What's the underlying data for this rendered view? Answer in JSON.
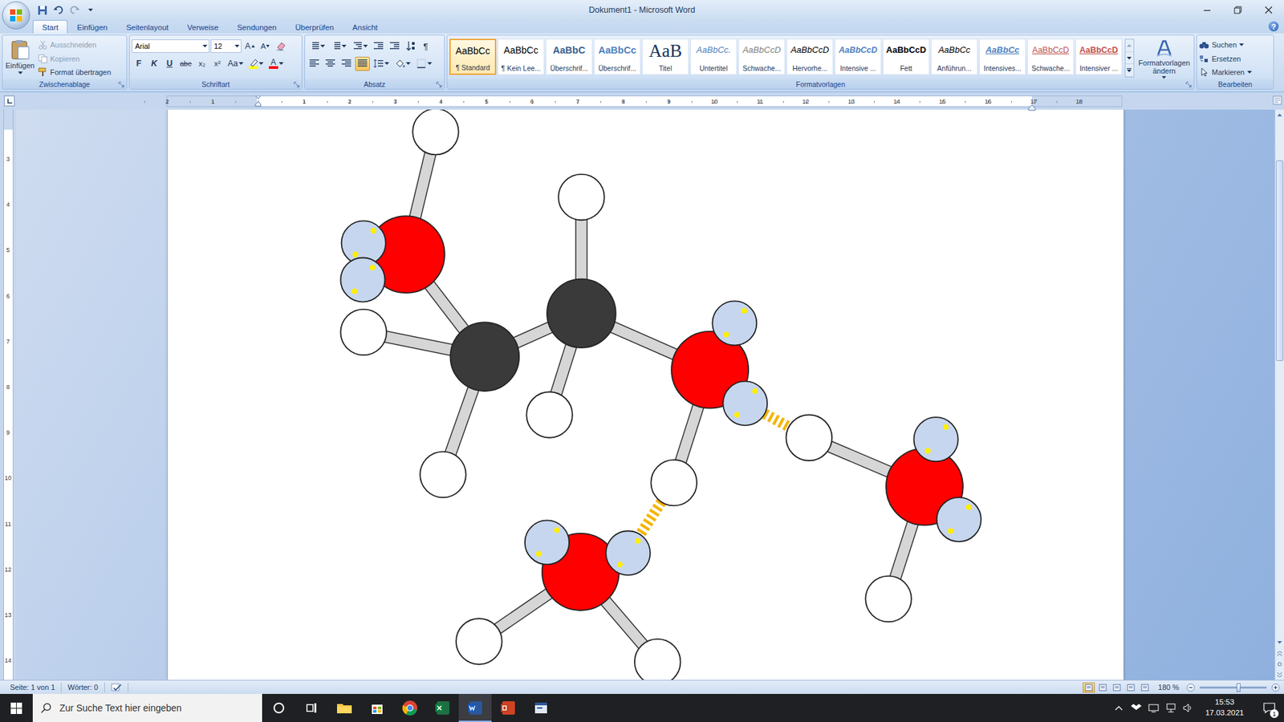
{
  "window": {
    "title": "Dokument1 - Microsoft Word",
    "help": "?"
  },
  "ribbon_tabs": [
    {
      "label": "Start",
      "selected": true
    },
    {
      "label": "Einfügen",
      "selected": false
    },
    {
      "label": "Seitenlayout",
      "selected": false
    },
    {
      "label": "Verweise",
      "selected": false
    },
    {
      "label": "Sendungen",
      "selected": false
    },
    {
      "label": "Überprüfen",
      "selected": false
    },
    {
      "label": "Ansicht",
      "selected": false
    }
  ],
  "clipboard": {
    "label": "Zwischenablage",
    "paste": "Einfügen",
    "items": [
      {
        "label": "Ausschneiden",
        "disabled": true
      },
      {
        "label": "Kopieren",
        "disabled": true
      },
      {
        "label": "Format übertragen",
        "disabled": false
      }
    ]
  },
  "font": {
    "label": "Schriftart",
    "family": "Arial",
    "size": "12",
    "grow": "A",
    "shrink": "A",
    "buttons": [
      {
        "label": "F",
        "kind": "bold"
      },
      {
        "label": "K",
        "kind": "italic"
      },
      {
        "label": "U",
        "kind": "underline"
      },
      {
        "label": "abe",
        "kind": "strike"
      },
      {
        "label": "x₂",
        "kind": "sub"
      },
      {
        "label": "x²",
        "kind": "sup"
      },
      {
        "label": "Aa",
        "kind": "case"
      }
    ],
    "highlight_color": "#ffff00",
    "color_letter": "A",
    "font_color": "#ff0000"
  },
  "paragraph": {
    "label": "Absatz",
    "pilcrow": "¶",
    "alignments": [
      {
        "kind": "left",
        "selected": false
      },
      {
        "kind": "center",
        "selected": false
      },
      {
        "kind": "right",
        "selected": false
      },
      {
        "kind": "justify",
        "selected": true
      }
    ]
  },
  "styles": {
    "label": "Formatvorlagen",
    "change": "Formatvorlagen ändern",
    "items": [
      {
        "preview": "AaBbCc",
        "label": "¶ Standard",
        "selected": true,
        "kind": "normal",
        "color": "#000000"
      },
      {
        "preview": "AaBbCc",
        "label": "¶ Kein Lee...",
        "selected": false,
        "kind": "normal",
        "color": "#000000"
      },
      {
        "preview": "AaBbC",
        "label": "Überschrif...",
        "selected": false,
        "kind": "heading",
        "color": "#365f91"
      },
      {
        "preview": "AaBbCc",
        "label": "Überschrif...",
        "selected": false,
        "kind": "heading",
        "color": "#4f81bd"
      },
      {
        "preview": "AaB",
        "label": "Titel",
        "selected": false,
        "kind": "title",
        "color": "#17365d"
      },
      {
        "preview": "AaBbCc.",
        "label": "Untertitel",
        "selected": false,
        "kind": "emphasis",
        "color": "#4f81bd"
      },
      {
        "preview": "AaBbCcD",
        "label": "Schwache...",
        "selected": false,
        "kind": "emphasis",
        "color": "#808080"
      },
      {
        "preview": "AaBbCcD",
        "label": "Hervorhe...",
        "selected": false,
        "kind": "emphasis",
        "color": "#000000"
      },
      {
        "preview": "AaBbCcD",
        "label": "Intensive ...",
        "selected": false,
        "kind": "strong-emphasis",
        "color": "#4f81bd"
      },
      {
        "preview": "AaBbCcD",
        "label": "Fett",
        "selected": false,
        "kind": "strong",
        "color": "#000000"
      },
      {
        "preview": "AaBbCc",
        "label": "Anführun...",
        "selected": false,
        "kind": "emphasis",
        "color": "#000000"
      },
      {
        "preview": "AaBbCc",
        "label": "Intensives...",
        "selected": false,
        "kind": "intense-quote",
        "color": "#4f81bd"
      },
      {
        "preview": "AaBbCcD",
        "label": "Schwache...",
        "selected": false,
        "kind": "reference",
        "color": "#c0504d"
      },
      {
        "preview": "AaBbCcD",
        "label": "Intensiver ...",
        "selected": false,
        "kind": "strong-reference",
        "color": "#c0504d"
      }
    ]
  },
  "editing": {
    "label": "Bearbeiten",
    "items": [
      {
        "label": "Suchen",
        "kind": "find"
      },
      {
        "label": "Ersetzen",
        "kind": "replace"
      },
      {
        "label": "Markieren",
        "kind": "select"
      }
    ]
  },
  "ruler": {
    "left": [
      "2",
      "1"
    ],
    "right": [
      "1",
      "2",
      "3",
      "4",
      "5",
      "6",
      "7",
      "8",
      "9",
      "10",
      "11",
      "12",
      "13",
      "14",
      "15",
      "16",
      "17",
      "18"
    ],
    "vertical": [
      "3",
      "4",
      "5",
      "6",
      "7",
      "8",
      "9",
      "10",
      "11",
      "12",
      "13",
      "14"
    ]
  },
  "molecule": {
    "atoms": [
      {
        "kind": "oxygen",
        "color": "#ff0000"
      },
      {
        "kind": "hydrogen",
        "color": "#ffffff"
      },
      {
        "kind": "carbon",
        "color": "#3a3a3a"
      },
      {
        "kind": "hydrogen",
        "color": "#ffffff"
      },
      {
        "kind": "hydrogen",
        "color": "#ffffff"
      },
      {
        "kind": "carbon",
        "color": "#3a3a3a"
      },
      {
        "kind": "hydrogen",
        "color": "#ffffff"
      },
      {
        "kind": "hydrogen",
        "color": "#ffffff"
      },
      {
        "kind": "oxygen",
        "color": "#ff0000"
      },
      {
        "kind": "hydrogen",
        "color": "#ffffff"
      },
      {
        "kind": "oxygen",
        "color": "#ff0000"
      },
      {
        "kind": "hydrogen",
        "color": "#ffffff"
      },
      {
        "kind": "hydrogen",
        "color": "#ffffff"
      },
      {
        "kind": "oxygen",
        "color": "#ff0000"
      },
      {
        "kind": "hydrogen",
        "color": "#ffffff"
      },
      {
        "kind": "hydrogen",
        "color": "#ffffff"
      },
      {
        "kind": "lone-pair",
        "color": "#c6d6ee"
      },
      {
        "kind": "lone-pair",
        "color": "#c6d6ee"
      },
      {
        "kind": "lone-pair",
        "color": "#c6d6ee"
      },
      {
        "kind": "lone-pair",
        "color": "#c6d6ee"
      },
      {
        "kind": "lone-pair",
        "color": "#c6d6ee"
      },
      {
        "kind": "lone-pair",
        "color": "#c6d6ee"
      },
      {
        "kind": "lone-pair",
        "color": "#c6d6ee"
      },
      {
        "kind": "lone-pair",
        "color": "#c6d6ee"
      }
    ]
  },
  "status_bar": {
    "page": "Seite: 1 von 1",
    "words": "Wörter: 0",
    "zoom": "180 %",
    "zoom_level": 0.58,
    "views": [
      {
        "kind": "print",
        "selected": true
      },
      {
        "kind": "reading",
        "selected": false
      },
      {
        "kind": "web",
        "selected": false
      },
      {
        "kind": "outline",
        "selected": false
      },
      {
        "kind": "draft",
        "selected": false
      }
    ]
  },
  "taskbar": {
    "search": "Zur Suche Text hier eingeben",
    "time": "15:53",
    "date": "17.03.2021",
    "notifications": "1",
    "apps": [
      {
        "kind": "cortana",
        "active": false
      },
      {
        "kind": "taskview",
        "active": false
      },
      {
        "kind": "explorer",
        "active": false
      },
      {
        "kind": "store",
        "active": false
      },
      {
        "kind": "chrome",
        "active": false
      },
      {
        "kind": "excel",
        "active": false
      },
      {
        "kind": "word",
        "active": true
      },
      {
        "kind": "powerpoint",
        "active": false
      },
      {
        "kind": "other",
        "active": false
      }
    ]
  }
}
